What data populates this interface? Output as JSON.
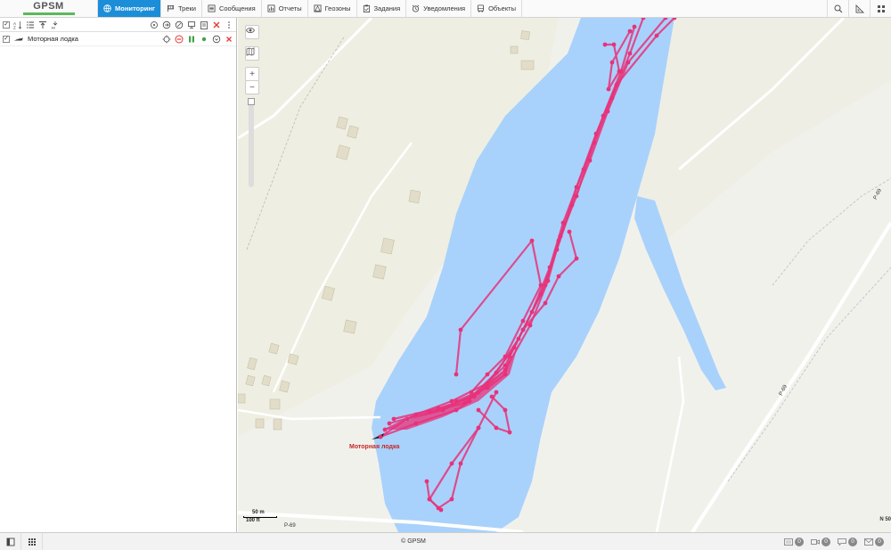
{
  "app": {
    "logo_text": "GPSM"
  },
  "nav": {
    "tabs": [
      {
        "label": "Мониторинг",
        "icon": "globe-icon",
        "active": true
      },
      {
        "label": "Треки",
        "icon": "flag-icon",
        "active": false
      },
      {
        "label": "Сообщения",
        "icon": "list-icon",
        "active": false
      },
      {
        "label": "Отчеты",
        "icon": "report-icon",
        "active": false
      },
      {
        "label": "Геозоны",
        "icon": "geofence-icon",
        "active": false
      },
      {
        "label": "Задания",
        "icon": "clipboard-icon",
        "active": false
      },
      {
        "label": "Уведомления",
        "icon": "alarm-clock-icon",
        "active": false
      },
      {
        "label": "Объекты",
        "icon": "bus-icon",
        "active": false
      }
    ],
    "accent": "#1b8ed7"
  },
  "units": {
    "items": [
      {
        "name": "Моторная лодка",
        "checked": true
      }
    ]
  },
  "map": {
    "unit_label": "Моторная лодка",
    "scale_top": "50 m",
    "scale_bottom": "100 ft",
    "road_label": "Р-69",
    "road_label_right": "Р-69",
    "corner_label": "N 50",
    "track_color": "#e8327a",
    "water_color": "#a8d2fb",
    "zoom_in": "+",
    "zoom_out": "−"
  },
  "footer": {
    "copyright": "© GPSM",
    "counters": [
      {
        "icon": "sms-icon",
        "value": "0"
      },
      {
        "icon": "video-icon",
        "value": "0"
      },
      {
        "icon": "chat-icon",
        "value": "0"
      },
      {
        "icon": "envelope-icon",
        "value": "0"
      }
    ]
  }
}
